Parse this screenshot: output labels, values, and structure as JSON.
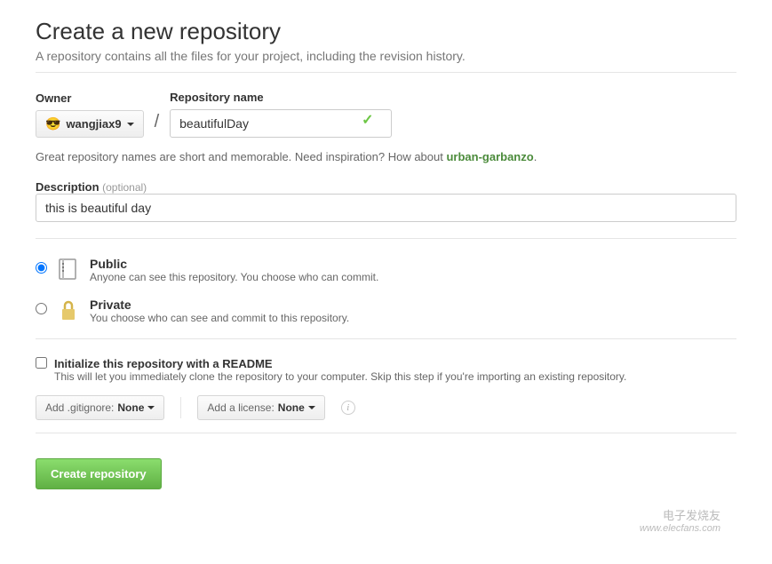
{
  "header": {
    "title": "Create a new repository",
    "subtitle": "A repository contains all the files for your project, including the revision history."
  },
  "owner": {
    "label": "Owner",
    "username": "wangjiax9"
  },
  "repo": {
    "label": "Repository name",
    "value": "beautifulDay"
  },
  "hint": {
    "prefix": "Great repository names are short and memorable. Need inspiration? How about ",
    "suggestion": "urban-garbanzo",
    "suffix": "."
  },
  "description": {
    "label": "Description",
    "optional": "(optional)",
    "value": "this is beautiful day"
  },
  "visibility": {
    "public": {
      "title": "Public",
      "desc": "Anyone can see this repository. You choose who can commit."
    },
    "private": {
      "title": "Private",
      "desc": "You choose who can see and commit to this repository."
    }
  },
  "readme": {
    "title": "Initialize this repository with a README",
    "desc": "This will let you immediately clone the repository to your computer. Skip this step if you're importing an existing repository."
  },
  "selectors": {
    "gitignore_prefix": "Add .gitignore: ",
    "gitignore_value": "None",
    "license_prefix": "Add a license: ",
    "license_value": "None"
  },
  "submit": {
    "label": "Create repository"
  },
  "watermark": {
    "line1": "电子发烧友",
    "line2": "www.elecfans.com"
  }
}
